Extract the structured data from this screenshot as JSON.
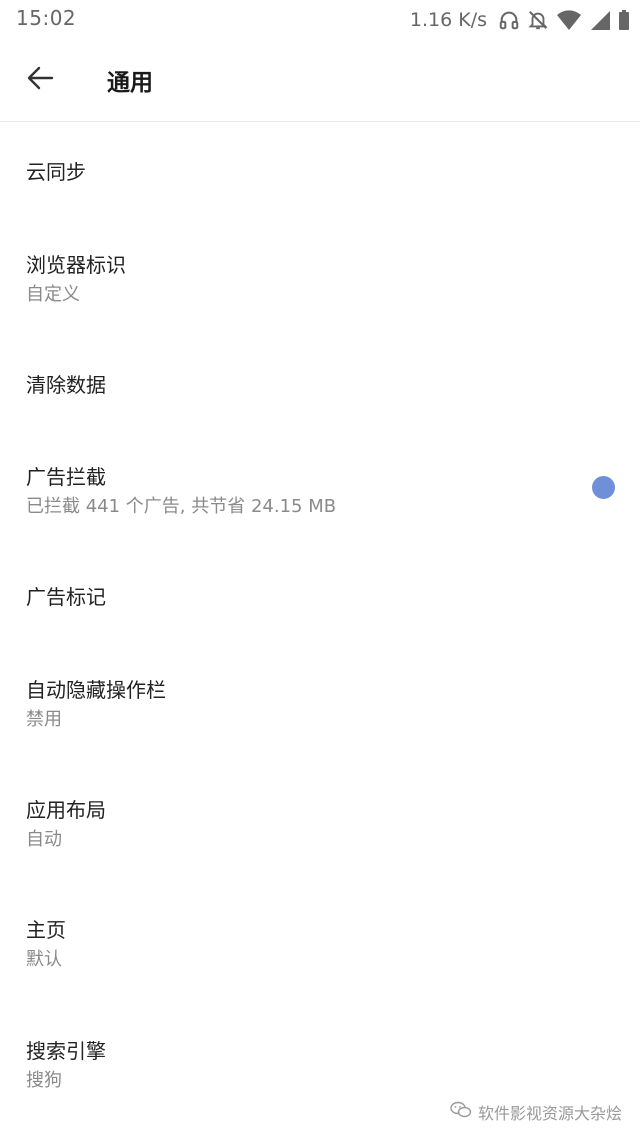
{
  "status_bar": {
    "time": "15:02",
    "net_speed": "1.16 K/s",
    "icons": [
      "headphones-icon",
      "bell-off-icon",
      "wifi-icon",
      "signal-icon",
      "battery-icon"
    ]
  },
  "header": {
    "back_icon": "arrow-left-icon",
    "title": "通用"
  },
  "settings": [
    {
      "title": "云同步",
      "subtitle": ""
    },
    {
      "title": "浏览器标识",
      "subtitle": "自定义"
    },
    {
      "title": "清除数据",
      "subtitle": ""
    },
    {
      "title": "广告拦截",
      "subtitle": "已拦截 441 个广告, 共节省 24.15 MB",
      "toggle": true
    },
    {
      "title": "广告标记",
      "subtitle": ""
    },
    {
      "title": "自动隐藏操作栏",
      "subtitle": "禁用"
    },
    {
      "title": "应用布局",
      "subtitle": "自动"
    },
    {
      "title": "主页",
      "subtitle": "默认"
    },
    {
      "title": "搜索引擎",
      "subtitle": "搜狗"
    }
  ],
  "watermark": {
    "icon": "wechat-icon",
    "text": "软件影视资源大杂烩"
  },
  "colors": {
    "accent": "#6f8fd9",
    "secondary_text": "#8a8a8a"
  }
}
